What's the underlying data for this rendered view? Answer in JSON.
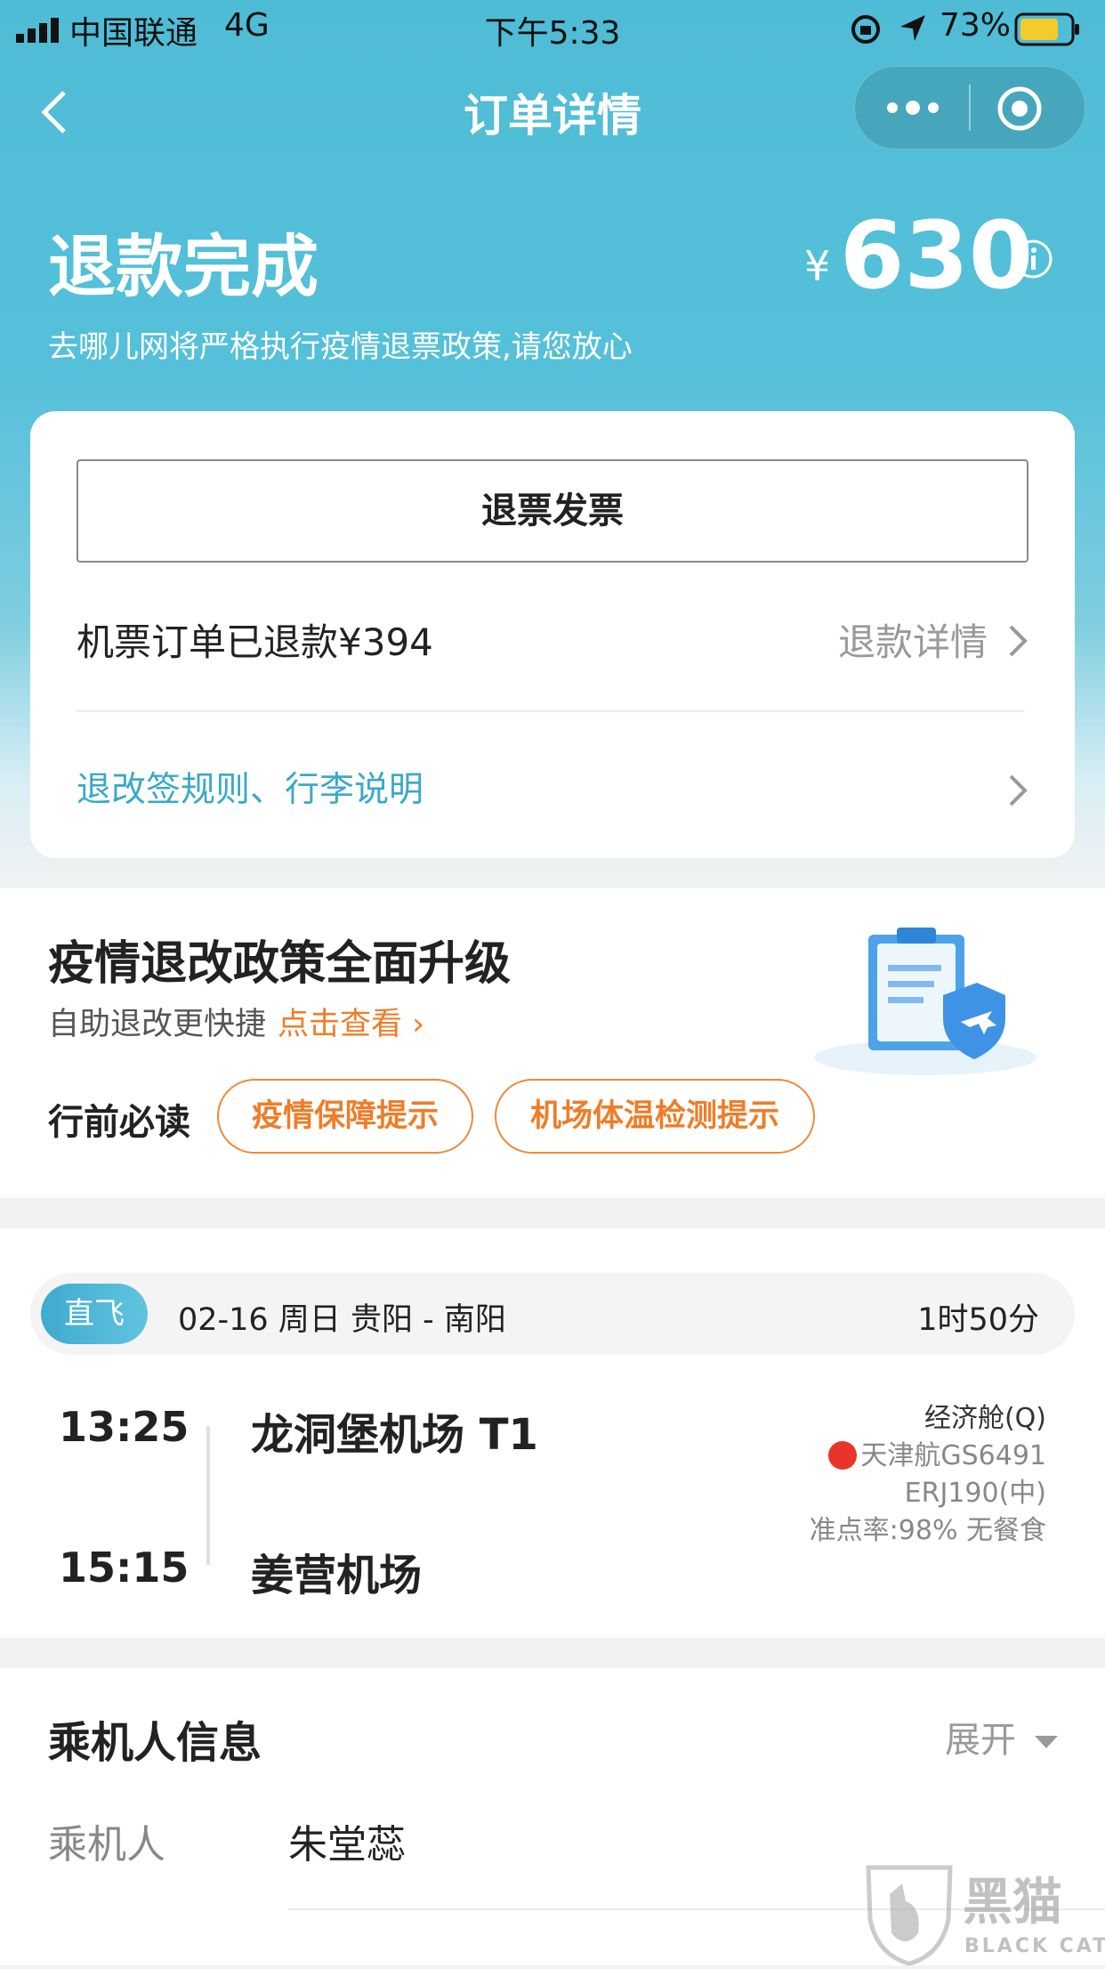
{
  "status_bar": {
    "carrier": "中国联通",
    "network": "4G",
    "time": "下午5:33",
    "battery": "73%"
  },
  "nav": {
    "title": "订单详情",
    "more_icon": "more-dots-icon",
    "close_icon": "target-close-icon",
    "back_icon": "back-chevron-icon"
  },
  "header": {
    "status": "退款完成",
    "currency": "¥",
    "amount": "630",
    "subtitle": "去哪儿网将严格执行疫情退票政策,请您放心"
  },
  "refund_card": {
    "invoice_button": "退票发票",
    "refund_text": "机票订单已退款¥394",
    "refund_detail_link": "退款详情",
    "rules_link": "退改签规则、行李说明"
  },
  "policy": {
    "title": "疫情退改政策全面升级",
    "subtitle": "自助退改更快捷",
    "view_link": "点击查看",
    "must_read": "行前必读",
    "tags": [
      "疫情保障提示",
      "机场体温检测提示"
    ]
  },
  "flight": {
    "badge": "直飞",
    "route_info": "02-16 周日 贵阳 - 南阳",
    "duration": "1时50分",
    "depart_time": "13:25",
    "depart_airport": "龙洞堡机场 T1",
    "arrive_time": "15:15",
    "arrive_airport": "姜营机场",
    "cabin": "经济舱(Q)",
    "airline": "天津航GS6491",
    "aircraft": "ERJ190(中)",
    "punctuality": "准点率:98% 无餐食"
  },
  "passenger": {
    "section_title": "乘机人信息",
    "expand": "展开",
    "label": "乘机人",
    "name": "朱堂蕊"
  },
  "watermark": {
    "brand": "黑猫",
    "sub": "BLACK CAT"
  },
  "colors": {
    "header_blue": "#4fbcd6",
    "link_blue": "#3aa9c8",
    "orange": "#ef7d28"
  }
}
